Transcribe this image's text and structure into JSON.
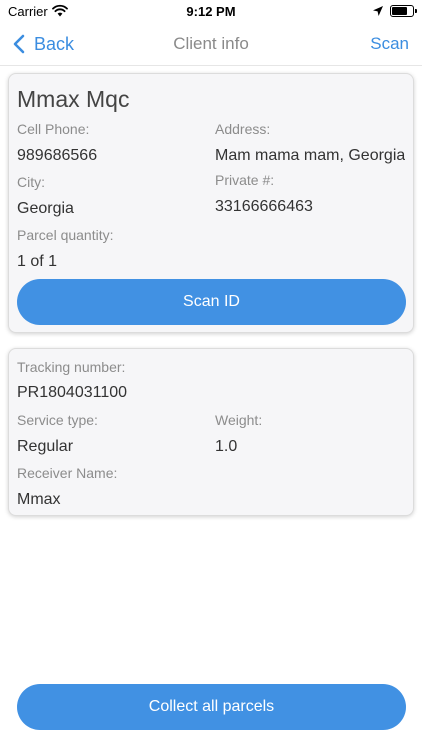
{
  "status_bar": {
    "carrier": "Carrier",
    "time": "9:12 PM",
    "battery_level": 0.75,
    "icons": [
      "wifi-icon",
      "location-arrow-icon",
      "battery-icon"
    ]
  },
  "nav": {
    "back_label": "Back",
    "title": "Client info",
    "scan_label": "Scan"
  },
  "client": {
    "name": "Mmax Mqc",
    "cell_phone_label": "Cell Phone:",
    "cell_phone": "989686566",
    "address_label": "Address:",
    "address": "Mam mama mam, Georgia",
    "city_label": "City:",
    "city": "Georgia",
    "private_label": "Private #:",
    "private_number": "33166666463",
    "parcel_quantity_label": "Parcel quantity:",
    "parcel_quantity": "1 of 1",
    "scan_id_label": "Scan ID"
  },
  "parcel": {
    "tracking_label": "Tracking number:",
    "tracking_number": "PR1804031100",
    "service_type_label": "Service type:",
    "service_type": "Regular",
    "weight_label": "Weight:",
    "weight": "1.0",
    "receiver_label": "Receiver Name:",
    "receiver_name": "Mmax"
  },
  "footer": {
    "collect_label": "Collect all parcels"
  },
  "colors": {
    "accent": "#4191e3",
    "link": "#3b8de0",
    "card_bg": "#f6f6f8"
  }
}
